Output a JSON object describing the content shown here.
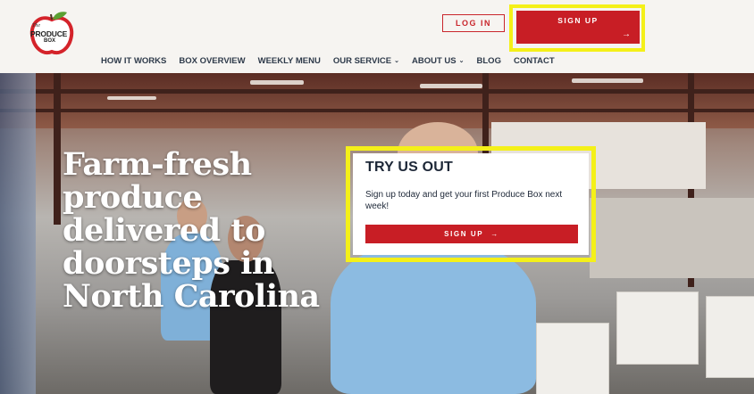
{
  "logo": {
    "the": "The",
    "main": "PRODUCE",
    "box": "BOX"
  },
  "header": {
    "login_label": "LOG IN",
    "signup_label": "SIGN UP",
    "signup_arrow": "→"
  },
  "nav": {
    "items": [
      {
        "label": "HOW IT WORKS",
        "chevron": ""
      },
      {
        "label": "BOX OVERVIEW",
        "chevron": ""
      },
      {
        "label": "WEEKLY MENU",
        "chevron": ""
      },
      {
        "label": "OUR SERVICE",
        "chevron": "⌄"
      },
      {
        "label": "ABOUT US",
        "chevron": "⌄"
      },
      {
        "label": "BLOG",
        "chevron": ""
      },
      {
        "label": "CONTACT",
        "chevron": ""
      }
    ]
  },
  "hero": {
    "title": "Farm-fresh produce delivered to doorsteps in North Carolina"
  },
  "card": {
    "title": "TRY US OUT",
    "text": "Sign up today and get your first Produce Box next week!",
    "button_label": "SIGN UP",
    "button_arrow": "→"
  },
  "colors": {
    "brand_red": "#c81e25",
    "highlight_yellow": "#f4f019",
    "nav_text": "#2e3a4a"
  }
}
